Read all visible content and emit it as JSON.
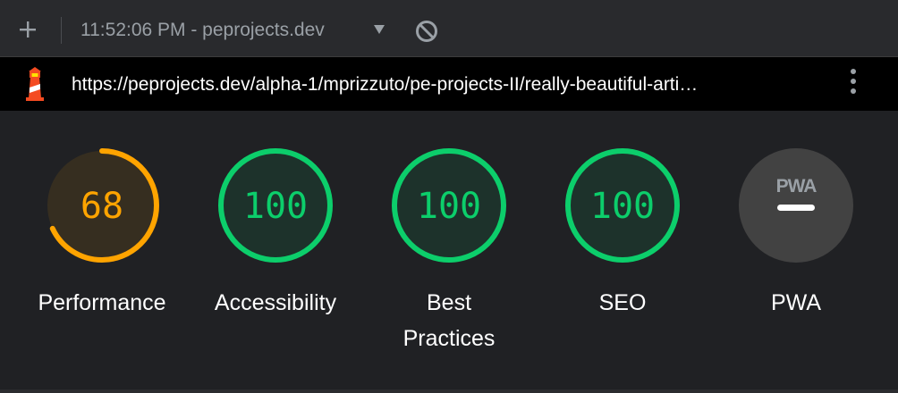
{
  "toolbar": {
    "title": "11:52:06 PM - peprojects.dev"
  },
  "url_bar": {
    "url": "https://peprojects.dev/alpha-1/mprizzuto/pe-projects-II/really-beautiful-arti…"
  },
  "colors": {
    "average": "#ffa400",
    "pass": "#0cce6b",
    "neutral": "#9aa0a6"
  },
  "categories": [
    {
      "label": "Performance",
      "score": "68",
      "fraction": 0.68,
      "status": "average"
    },
    {
      "label": "Accessibility",
      "score": "100",
      "fraction": 1.0,
      "status": "pass"
    },
    {
      "label": "Best Practices",
      "score": "100",
      "fraction": 1.0,
      "status": "pass"
    },
    {
      "label": "SEO",
      "score": "100",
      "fraction": 1.0,
      "status": "pass"
    },
    {
      "label": "PWA",
      "badge": "PWA",
      "status": "not-applicable"
    }
  ]
}
